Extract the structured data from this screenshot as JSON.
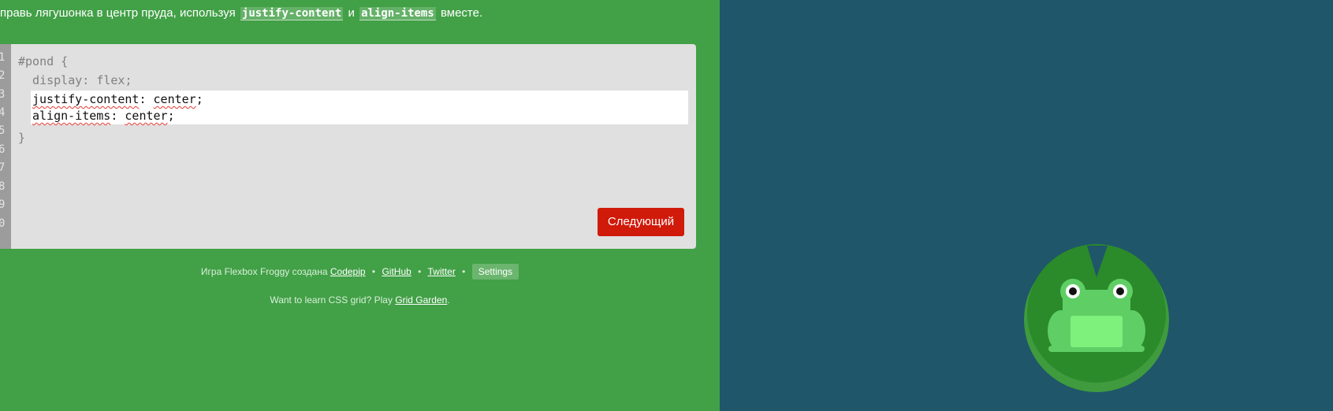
{
  "instructions": {
    "prefix": "правь лягушонка в центр пруда, используя",
    "code1": "justify-content",
    "middle": "и",
    "code2": "align-items",
    "suffix": "вместе."
  },
  "editor": {
    "line_numbers": [
      "1",
      "2",
      "3",
      "4",
      "5",
      "6",
      "7",
      "8",
      "9",
      "0"
    ],
    "line1": "#pond {",
    "line2": "  display: flex;",
    "answer_line1_prop": "justify-content",
    "answer_line1_sep": ": ",
    "answer_line1_value": "center",
    "answer_line1_end": ";",
    "answer_line2_prop": "align-items",
    "answer_line2_sep": ": ",
    "answer_line2_value": "center",
    "answer_line2_end": ";",
    "closing": "}",
    "next_button_label": "Следующий"
  },
  "footer": {
    "credit_prefix": "Игра Flexbox Froggy создана",
    "codepip_link": "Codepip",
    "separator": "•",
    "github_link": "GitHub",
    "twitter_link": "Twitter",
    "settings_label": "Settings",
    "grid_prefix": "Want to learn CSS grid? Play",
    "grid_link": "Grid Garden",
    "grid_suffix": "."
  },
  "pond": {
    "frog_color": "green",
    "colors": {
      "sidebar_bg": "#42a047",
      "pond_bg": "#1f566a",
      "lilypad_outer": "#3f9b3e",
      "lilypad_inner": "#2b8a2a",
      "frog_body": "#5fcf65",
      "frog_belly": "#7ef07c",
      "next_button": "#d01a0a"
    }
  }
}
